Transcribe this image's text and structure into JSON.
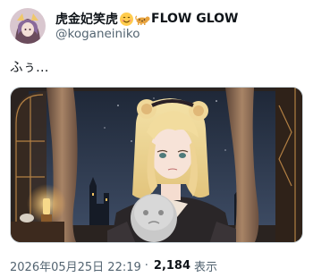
{
  "author": {
    "display_name": "虎金妃笑虎",
    "display_suffix": "FLOW GLOW",
    "handle": "@koganeiniko",
    "emoji_icons": [
      "smiling-face-icon",
      "leopard-icon"
    ]
  },
  "tweet": {
    "text": "ふぅ…",
    "timestamp": "2026年05月25日 22:19",
    "separator": "·",
    "views_count": "2,184",
    "views_label": "表示"
  },
  "colors": {
    "text_primary": "#0f1419",
    "text_secondary": "#536471",
    "border": "#cfd9de"
  }
}
